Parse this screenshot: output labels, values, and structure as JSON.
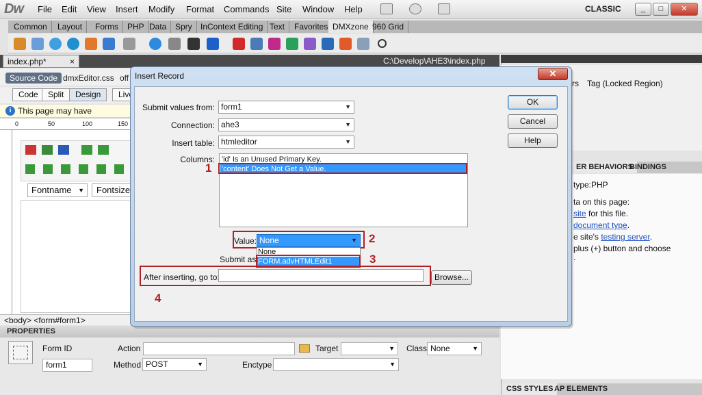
{
  "app": {
    "logo": "Dw",
    "menu": [
      "File",
      "Edit",
      "View",
      "Insert",
      "Modify",
      "Format",
      "Commands",
      "Site",
      "Window",
      "Help"
    ],
    "workspace": "CLASSIC",
    "window_buttons": [
      "_",
      "□",
      "✕"
    ]
  },
  "insert_tabs": [
    "Common",
    "Layout",
    "Forms",
    "PHP",
    "Data",
    "Spry",
    "InContext Editing",
    "Text",
    "Favorites",
    "DMXzone",
    "960 Grid"
  ],
  "active_insert_tab": "DMXzone",
  "document": {
    "tab": "index.php*",
    "tab_close": "×",
    "path": "C:\\Develop\\AHE3\\index.php",
    "source_code": "Source Code",
    "related_files": [
      "dmxEditor.css",
      "off"
    ],
    "views": [
      "Code",
      "Split",
      "Design",
      "Live"
    ],
    "active_view": "Design",
    "info_bar": "This page may have dynamically-r",
    "ruler_ticks": [
      "0",
      "50",
      "100",
      "150"
    ],
    "font_name": "Fontname",
    "font_size": "Fontsize",
    "tag_selector": "<body> <form#form1>"
  },
  "properties": {
    "header": "PROPERTIES",
    "form_id_label": "Form ID",
    "form_id": "form1",
    "action_label": "Action",
    "action": "",
    "target_label": "Target",
    "target": "",
    "class_label": "Class",
    "class": "None",
    "method_label": "Method",
    "method": "POST",
    "enctype_label": "Enctype",
    "enctype": ""
  },
  "right_panel": {
    "tag_region": "Tag (Locked Region)",
    "tab_partial": "rs",
    "tabs": [
      "ER BEHAVIORS",
      "BINDINGS"
    ],
    "doc_type": "type:PHP",
    "lines": [
      {
        "text": "ta on this page:",
        "link": ""
      },
      {
        "text": "",
        "link": "site",
        "after": " for this file."
      },
      {
        "text": "",
        "link": "document type",
        "after": "."
      },
      {
        "text": "e site's ",
        "link": "testing server",
        "after": "."
      },
      {
        "text": "plus (+) button and choose",
        "link": ""
      },
      {
        "text": ".",
        "link": ""
      }
    ],
    "bottom_tabs": [
      "CSS STYLES",
      "AP ELEMENTS"
    ]
  },
  "dialog": {
    "title": "Insert Record",
    "close": "✕",
    "submit_from_label": "Submit values from:",
    "submit_from": "form1",
    "connection_label": "Connection:",
    "connection": "ahe3",
    "table_label": "Insert table:",
    "table": "htmleditor",
    "columns_label": "Columns:",
    "columns": [
      "'id' Is an Unused Primary Key.",
      "'content' Does Not Get a Value."
    ],
    "selected_column_index": 1,
    "value_label": "Value:",
    "value": "None",
    "value_options": [
      "None",
      "FORM.advHTMLEdit1"
    ],
    "submit_as_label": "Submit as:",
    "after_label": "After inserting, go to:",
    "after_value": "",
    "browse": "Browse...",
    "ok": "OK",
    "cancel": "Cancel",
    "help": "Help"
  },
  "callouts": [
    "1",
    "2",
    "3",
    "4"
  ],
  "colors": {
    "highlight": "#b01f24",
    "selection": "#3399ff",
    "link": "#1a4fc4"
  }
}
